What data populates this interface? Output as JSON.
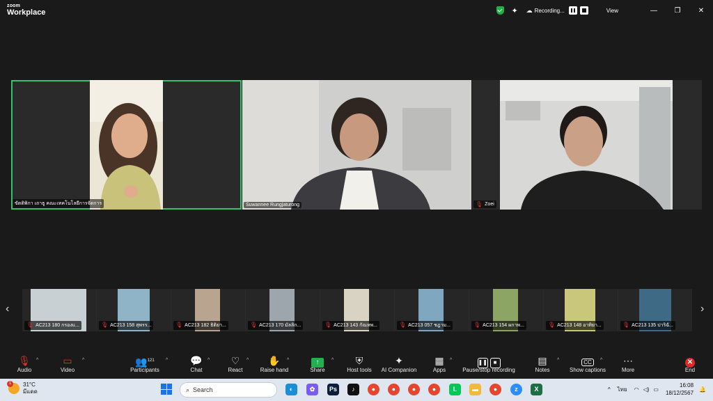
{
  "titlebar": {
    "brand_small": "zoom",
    "brand_big": "Workplace",
    "recording_label": "Recording...",
    "view_label": "View",
    "min": "—",
    "restore": "❐",
    "close": "✕"
  },
  "gallery": {
    "tiles": [
      {
        "label": "ขัตติพิกา เถาธู คณะเทคโนโลยีการจัดการ",
        "active": true
      },
      {
        "label": "Suwannee Rungjaturong"
      },
      {
        "label": "Zoei"
      }
    ]
  },
  "filmstrip": {
    "thumbs": [
      "AC213 180 กรองแ...",
      "AC213 158 สุพรร...",
      "AC213 182 ธิติยา...",
      "AC213 170 มัลลิก...",
      "AC213 143 กัณหพ...",
      "AC213 057 ชฎาม...",
      "AC213 154 ผกาพ...",
      "AC213 148 อาทิยา...",
      "AC213 135 ปาริฉั..."
    ],
    "prev": "‹",
    "next": "›"
  },
  "toolbar": {
    "audio": "Audio",
    "video": "Video",
    "participants": "Participants",
    "participants_count": "121",
    "chat": "Chat",
    "react": "React",
    "raise_hand": "Raise hand",
    "share": "Share",
    "host_tools": "Host tools",
    "ai_companion": "AI Companion",
    "apps": "Apps",
    "pause_stop": "Pause/stop recording",
    "notes": "Notes",
    "captions": "Show captions",
    "more": "More",
    "end": "End"
  },
  "taskbar": {
    "weather_badge": "1",
    "temperature": "31°C",
    "weather_desc": "มีแดด",
    "search_placeholder": "Search",
    "lang": "ไทย",
    "time": "16:08",
    "date": "18/12/2567"
  },
  "colors": {
    "active_speaker": "#32c36c",
    "end_red": "#e02828",
    "share_green": "#22b14c",
    "taskbar_bg": "#dfe6f0"
  }
}
